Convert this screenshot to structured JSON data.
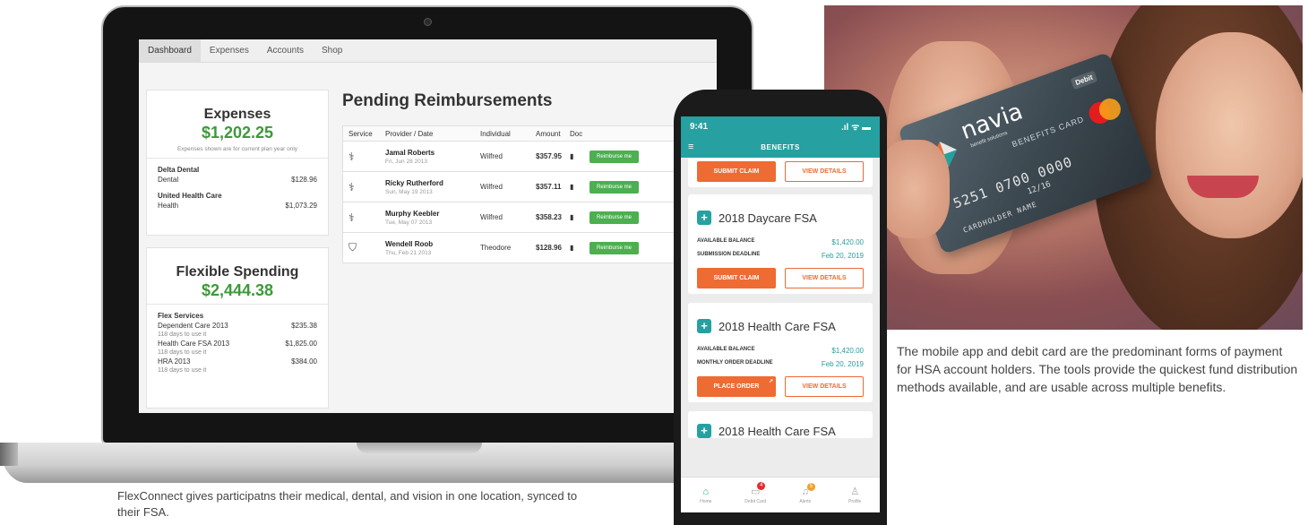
{
  "laptop": {
    "tabs": [
      "Dashboard",
      "Expenses",
      "Accounts",
      "Shop"
    ],
    "expenses": {
      "title": "Expenses",
      "amount": "$1,202.25",
      "note": "Expenses shown are for current plan year only",
      "providers": [
        {
          "name": "Delta Dental",
          "category": "Dental",
          "amount": "$128.96"
        },
        {
          "name": "United Health Care",
          "category": "Health",
          "amount": "$1,073.29"
        }
      ]
    },
    "flex": {
      "title": "Flexible Spending",
      "amount": "$2,444.38",
      "section": "Flex Services",
      "items": [
        {
          "name": "Dependent Care 2013",
          "amount": "$235.38",
          "sub": "118 days to use it"
        },
        {
          "name": "Health Care FSA 2013",
          "amount": "$1,825.00",
          "sub": "118 days to use it"
        },
        {
          "name": "HRA 2013",
          "amount": "$384.00",
          "sub": "118 days to use it"
        }
      ]
    },
    "pending": {
      "title": "Pending Reimbursements",
      "headers": [
        "Service",
        "Provider / Date",
        "Individual",
        "Amount",
        "Doc"
      ],
      "button_label": "Reimburse me",
      "rows": [
        {
          "icon": "stethoscope-icon",
          "provider": "Jamal Roberts",
          "date": "Fri, Jun 28 2013",
          "individual": "Wilfred",
          "amount": "$357.95"
        },
        {
          "icon": "stethoscope-icon",
          "provider": "Ricky Rutherford",
          "date": "Sun, May 19 2013",
          "individual": "Wilfred",
          "amount": "$357.11"
        },
        {
          "icon": "stethoscope-icon",
          "provider": "Murphy Keebler",
          "date": "Tue, May 07 2013",
          "individual": "Wilfred",
          "amount": "$358.23"
        },
        {
          "icon": "tooth-icon",
          "provider": "Wendell Roob",
          "date": "Thu, Feb 21 2013",
          "individual": "Theodore",
          "amount": "$128.96"
        }
      ]
    },
    "caption": "FlexConnect gives participatns their medical, dental, and vision in one location, synced to their FSA."
  },
  "phone": {
    "time": "9:41",
    "status_icons": ".ıl ᯤ ▬",
    "title": "BENEFITS",
    "top_buttons": {
      "primary": "SUBMIT CLAIM",
      "secondary": "VIEW DETAILS"
    },
    "cards": [
      {
        "title": "2018 Daycare FSA",
        "rows": [
          {
            "label": "AVAILABLE BALANCE",
            "value": "$1,420.00"
          },
          {
            "label": "SUBMISSION DEADLINE",
            "value": "Feb 20, 2019"
          }
        ],
        "primary": "SUBMIT CLAIM",
        "secondary": "VIEW DETAILS"
      },
      {
        "title": "2018 Health Care FSA",
        "rows": [
          {
            "label": "AVAILABLE BALANCE",
            "value": "$1,420.00"
          },
          {
            "label": "MONTHLY ORDER DEADLINE",
            "value": "Feb 20, 2019"
          }
        ],
        "primary": "PLACE ORDER",
        "secondary": "VIEW DETAILS"
      }
    ],
    "peek_title": "2018 Health Care FSA",
    "tabbar": [
      {
        "label": "Home",
        "icon": "home-icon"
      },
      {
        "label": "Debit Card",
        "icon": "card-icon",
        "badge": "4"
      },
      {
        "label": "Alerts",
        "icon": "bell-icon",
        "badge": "5"
      },
      {
        "label": "Profile",
        "icon": "person-icon"
      }
    ],
    "colors": {
      "teal": "#26a0a0",
      "orange": "#ee6b34"
    }
  },
  "photo": {
    "card": {
      "brand": "navia",
      "brand_sub": "benefit solutions",
      "type": "BENEFITS CARD",
      "debit": "Debit",
      "number": "5251 0700 0000",
      "expiry": "12/16",
      "name": "CARDHOLDER NAME",
      "network": "MasterCard"
    },
    "caption": "The mobile app and debit card are the predominant forms of payment for HSA account holders. The tools provide the quickest fund distribution methods available, and are usable across multiple benefits."
  }
}
